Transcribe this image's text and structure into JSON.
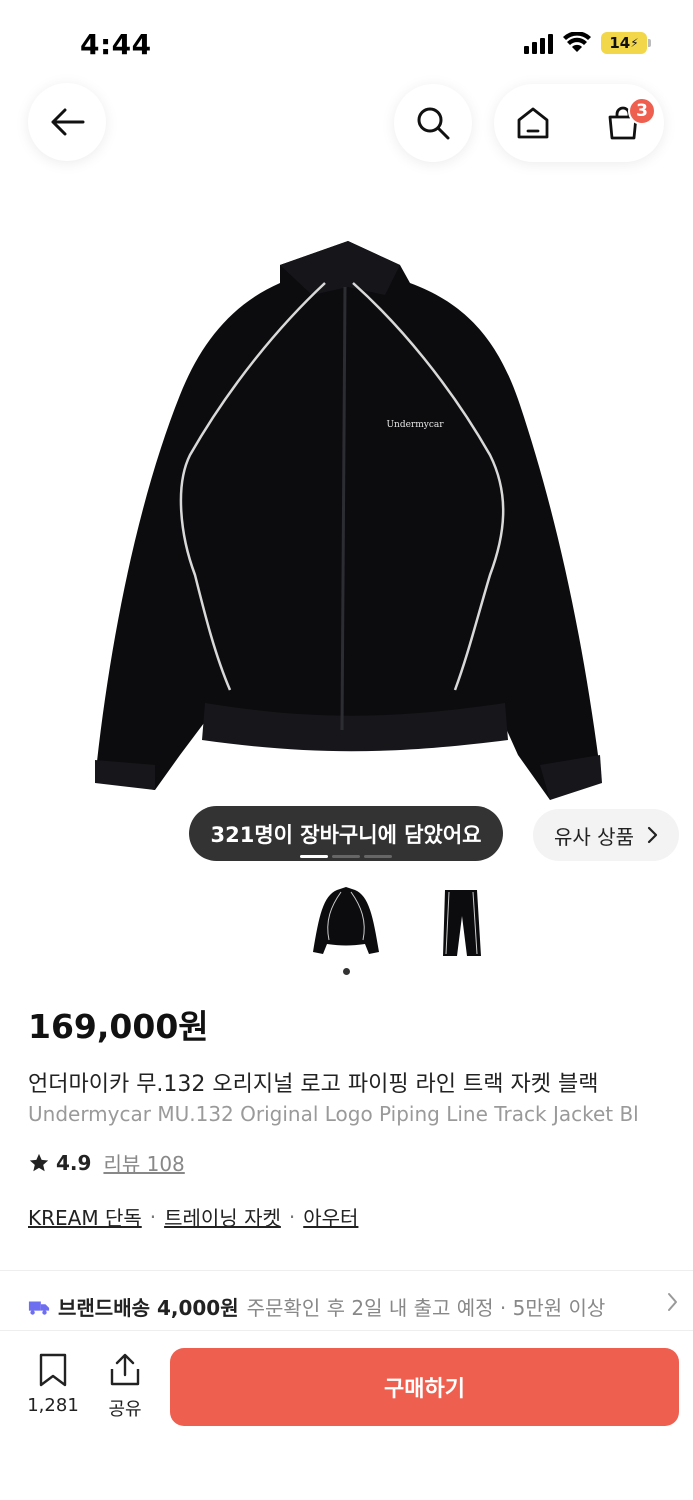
{
  "status_bar": {
    "time": "4:44",
    "battery": "14"
  },
  "nav": {
    "cart_count": "3"
  },
  "product": {
    "cart_toast": "321명이 장바구니에 담았어요",
    "similar_label": "유사 상품",
    "price": "169,000원",
    "title_ko": "언더마이카 무.132 오리지널 로고 파이핑 라인 트랙 자켓 블랙",
    "title_en": "Undermycar MU.132 Original Logo Piping Line Track Jacket Bl",
    "rating": "4.9",
    "reviews": "리뷰 108",
    "image_logo_text": "Undermycar"
  },
  "tags": [
    "KREAM 단독",
    "트레이닝 자켓",
    "아우터"
  ],
  "shipping": {
    "label": "브랜드배송 4,000원",
    "desc": "주문확인 후 2일 내 출고 예정 · 5만원 이상"
  },
  "bottom": {
    "bookmark_count": "1,281",
    "share_label": "공유",
    "buy_label": "구매하기"
  },
  "colors": {
    "accent": "#ef5f4f",
    "toast_bg": "#333333"
  }
}
